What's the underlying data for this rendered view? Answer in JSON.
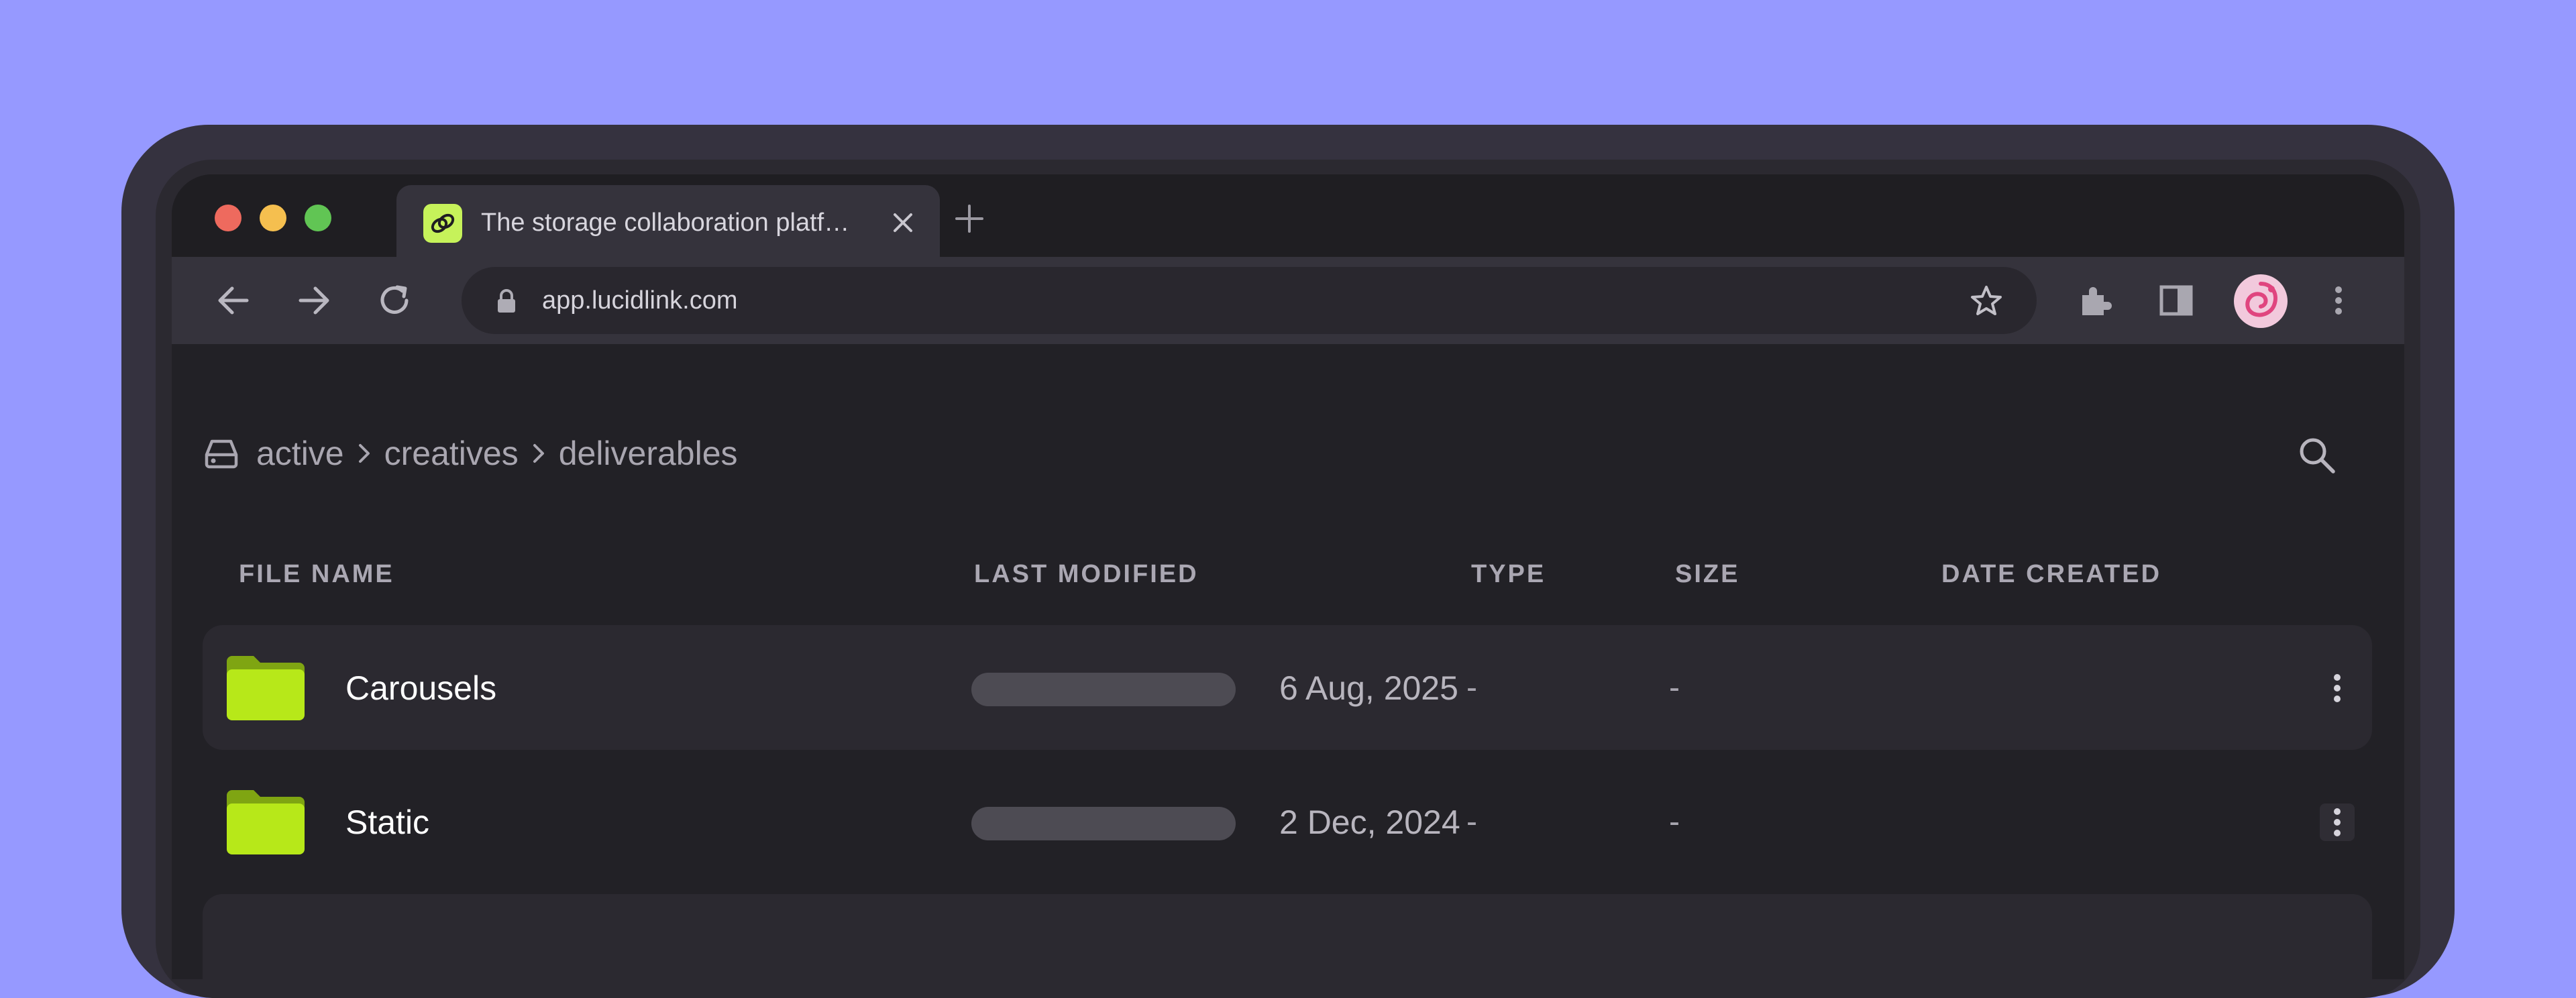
{
  "browser": {
    "tab_title": "The storage collaboration platf…",
    "url": "app.lucidlink.com"
  },
  "breadcrumb": {
    "items": [
      "active",
      "creatives",
      "deliverables"
    ]
  },
  "table": {
    "columns": {
      "file_name": "FILE NAME",
      "last_modified": "LAST MODIFIED",
      "type": "TYPE",
      "size": "SIZE",
      "date_created": "DATE CREATED"
    },
    "rows": [
      {
        "name": "Carousels",
        "type": "-",
        "size": "-",
        "date_created": "6 Aug, 2025"
      },
      {
        "name": "Static",
        "type": "-",
        "size": "-",
        "date_created": "2 Dec, 2024"
      }
    ]
  },
  "colors": {
    "background": "#9699ff",
    "folder": "#b7e819",
    "folder_tab": "#7fa512"
  },
  "icons": [
    "back-icon",
    "forward-icon",
    "reload-icon",
    "lock-icon",
    "star-icon",
    "extensions-icon",
    "sidepanel-icon",
    "kebab-icon",
    "drive-icon",
    "chevron-right-icon",
    "search-icon",
    "folder-icon"
  ]
}
